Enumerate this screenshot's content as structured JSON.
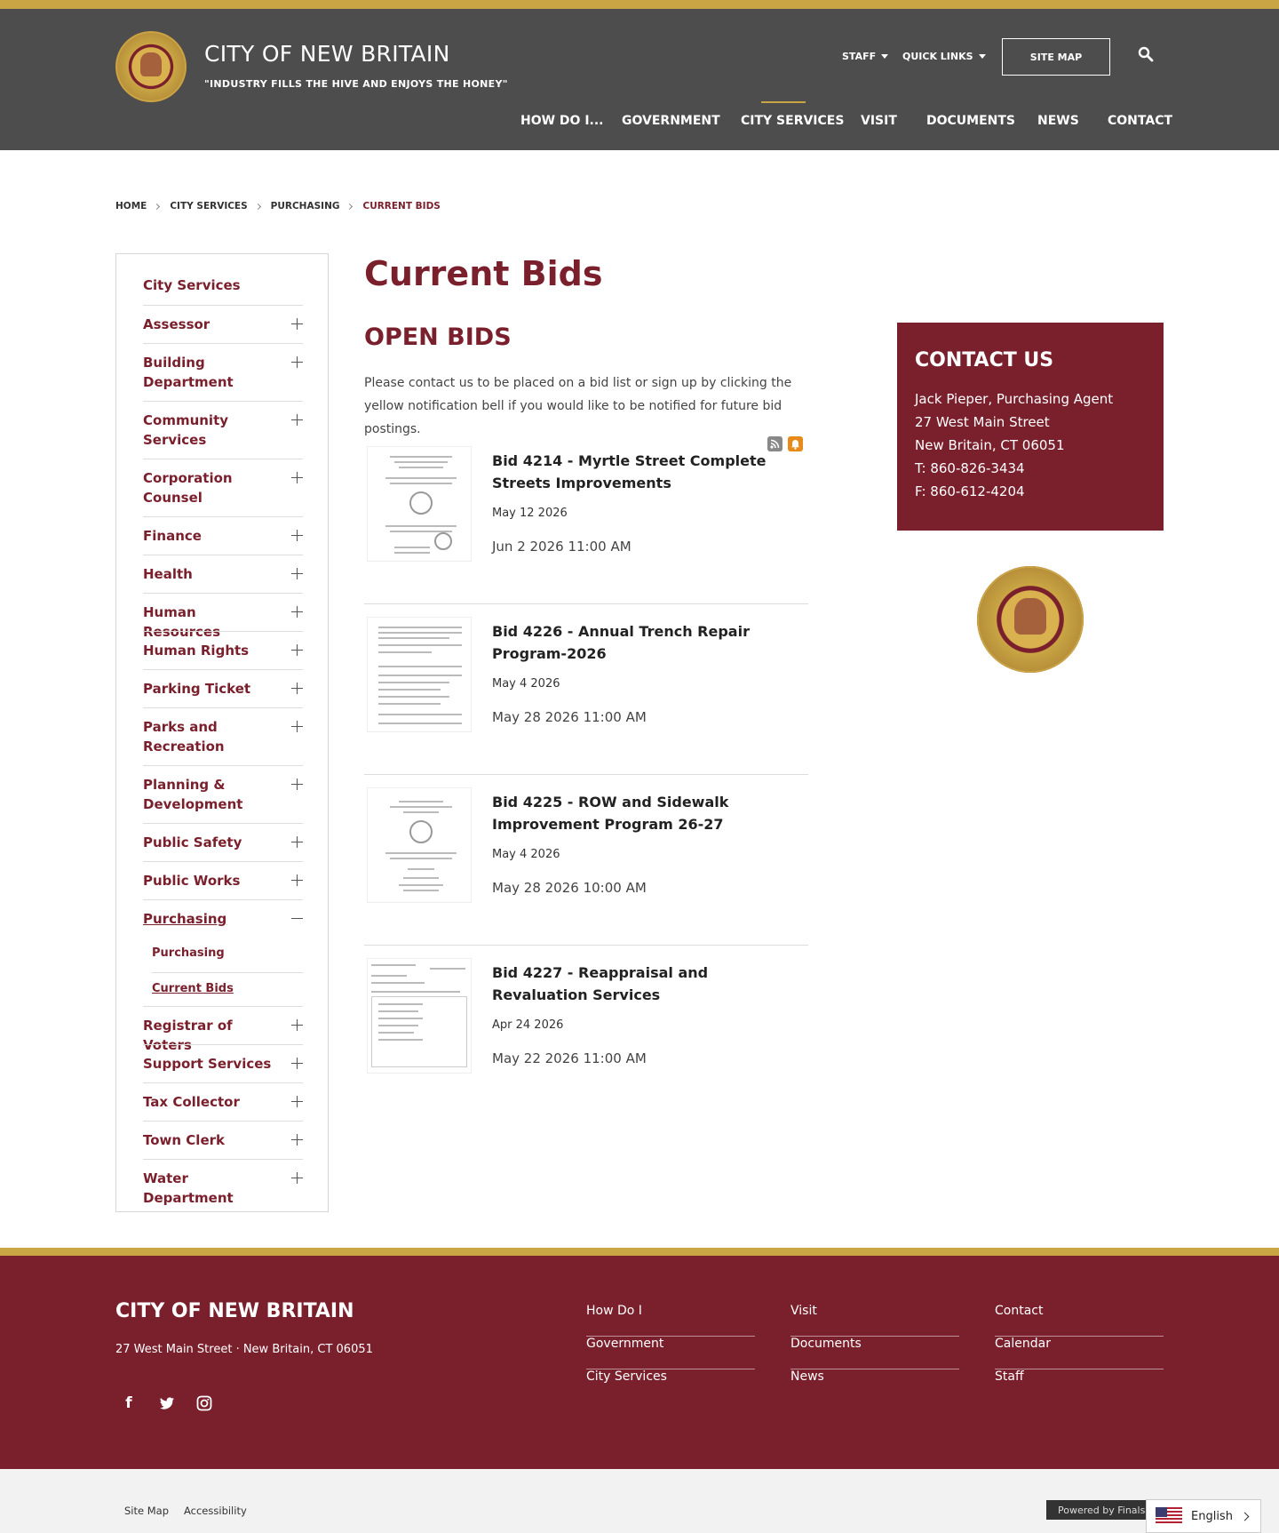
{
  "header": {
    "site_title": "CITY OF NEW BRITAIN",
    "motto": "\"INDUSTRY FILLS THE HIVE AND ENJOYS THE HONEY\"",
    "staff_label": "STAFF",
    "quick_links_label": "QUICK LINKS",
    "site_map_label": "SITE MAP",
    "nav": [
      "HOW DO I...",
      "GOVERNMENT",
      "CITY SERVICES",
      "VISIT",
      "DOCUMENTS",
      "NEWS",
      "CONTACT"
    ],
    "active_nav": "CITY SERVICES"
  },
  "breadcrumb": [
    "HOME",
    "CITY SERVICES",
    "PURCHASING",
    "CURRENT BIDS"
  ],
  "sidebar": {
    "title": "City Services",
    "items": [
      "Assessor",
      "Building Department",
      "Community Services",
      "Corporation Counsel",
      "Finance",
      "Health",
      "Human Resources",
      "Human Rights",
      "Parking Ticket",
      "Parks and Recreation",
      "Planning & Development",
      "Public Safety",
      "Public Works",
      "Purchasing",
      "Registrar of Voters",
      "Support Services",
      "Tax Collector",
      "Town Clerk",
      "Water Department"
    ],
    "expanded_item": "Purchasing",
    "sub_items": [
      "Purchasing",
      "Current Bids"
    ]
  },
  "main": {
    "page_title": "Current Bids",
    "section_title": "OPEN BIDS",
    "intro": "Please contact us to be placed on a bid list or sign up by clicking the yellow notification bell if you would like to be notified for future bid postings.",
    "bids": [
      {
        "title": "Bid 4214 - Myrtle Street Complete Streets Improvements",
        "posted": "May 12 2026",
        "closes": "Jun 2 2026 11:00 AM"
      },
      {
        "title": "Bid 4226 - Annual Trench Repair Program-2026",
        "posted": "May 4 2026",
        "closes": "May 28 2026 11:00 AM"
      },
      {
        "title": "Bid 4225 - ROW and Sidewalk Improvement Program 26-27",
        "posted": "May 4 2026",
        "closes": "May 28 2026 10:00 AM"
      },
      {
        "title": "Bid 4227 - Reappraisal and Revaluation Services",
        "posted": "Apr 24 2026",
        "closes": "May 22 2026 11:00 AM"
      }
    ]
  },
  "contact": {
    "title": "CONTACT US",
    "lines": [
      "Jack Pieper, Purchasing Agent",
      "27 West Main Street",
      "New Britain, CT 06051",
      "T: 860-826-3434",
      "F: 860-612-4204"
    ]
  },
  "footer": {
    "title": "CITY OF NEW BRITAIN",
    "address": "27 West Main Street  ·  New Britain, CT  06051",
    "social": [
      "facebook-icon",
      "twitter-icon",
      "instagram-icon"
    ],
    "links": [
      [
        "How Do I",
        "Government",
        "City Services"
      ],
      [
        "Visit",
        "Documents",
        "News"
      ],
      [
        "Contact",
        "Calendar",
        "Staff"
      ]
    ]
  },
  "bottom": {
    "site_map": "Site Map",
    "accessibility": "Accessibility",
    "powered_by": "Powered by Finalsite",
    "language": "English"
  },
  "colors": {
    "brand": "#7a1f2c",
    "gold": "#c9a544",
    "header_bg": "#4d4d4d"
  }
}
